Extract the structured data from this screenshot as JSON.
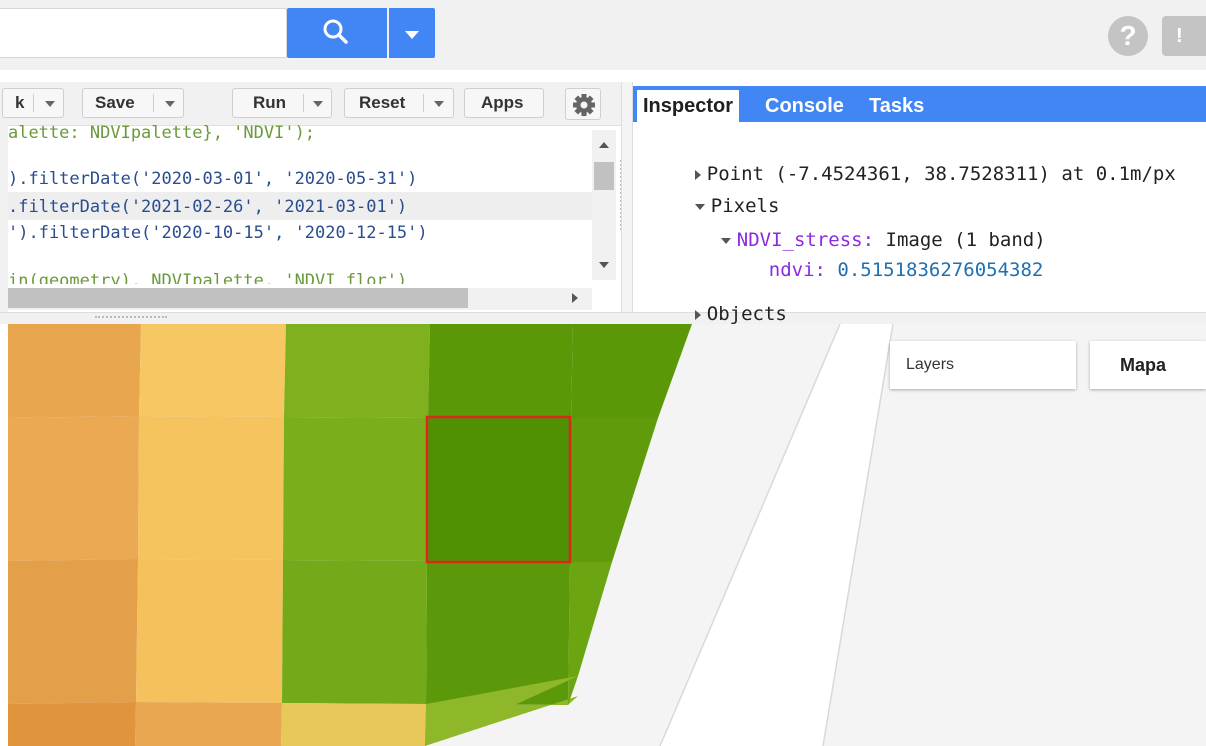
{
  "toolbar": {
    "partial_button": "k",
    "save_label": "Save",
    "run_label": "Run",
    "reset_label": "Reset",
    "apps_label": "Apps"
  },
  "code_lines": [
    "alette: NDVIpalette}, 'NDVI');",
    ").filterDate('2020-03-01', '2020-05-31')",
    ".filterDate('2021-02-26', '2021-03-01')",
    "').filterDate('2020-10-15', '2020-12-15')",
    "in(geometry), NDVIpalette, 'NDVI_flor')"
  ],
  "tabs": {
    "inspector": "Inspector",
    "console": "Console",
    "tasks": "Tasks"
  },
  "inspector": {
    "point_label": "Point (-7.4524361, 38.7528311) at 0.1m/px",
    "pixels_label": "Pixels",
    "layer_name": "NDVI_stress:",
    "layer_desc": "Image (1 band)",
    "band_name": "ndvi:",
    "band_value": "0.5151836276054382",
    "objects_label": "Objects"
  },
  "map": {
    "layers_label": "Layers",
    "map_type_label": "Mapa",
    "colors": {
      "orange": "#e8a64f",
      "light_orange": "#f5c45f",
      "green": "#7aae1c",
      "dark_green": "#4f9102",
      "selection": "#e0261b"
    }
  },
  "icons": [
    "search-icon",
    "dropdown-caret-icon",
    "help-icon",
    "feedback-icon",
    "gear-icon"
  ]
}
